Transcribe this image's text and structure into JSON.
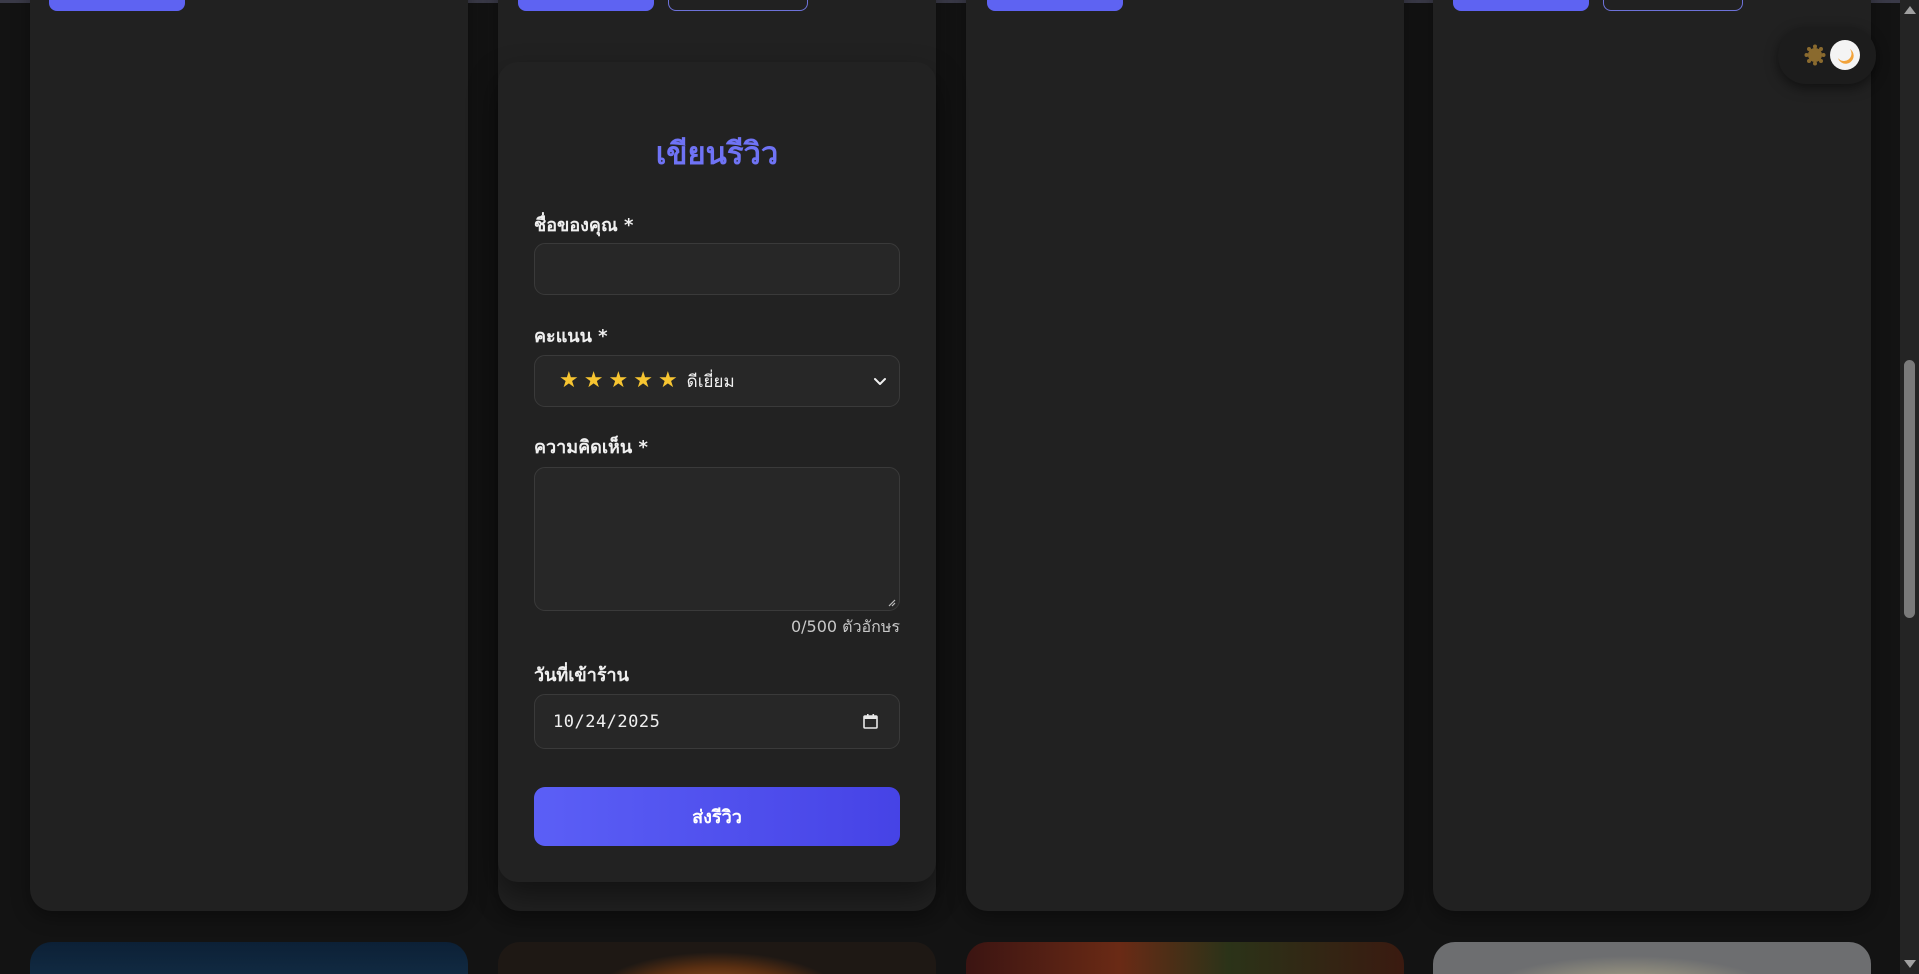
{
  "review_form": {
    "title": "เขียนรีวิว",
    "name_label": "ชื่อของคุณ *",
    "name_value": "",
    "rating_label": "คะแนน *",
    "rating_stars": 5,
    "rating_text": "ดีเยี่ยม",
    "comment_label": "ความคิดเห็น *",
    "comment_value": "",
    "char_count": "0/500 ตัวอักษร",
    "visit_date_label": "วันที่เข้าร้าน",
    "visit_date_value": "10/24/2025",
    "submit_label": "ส่งรีวิว"
  },
  "theme_toggle": {
    "mode": "dark",
    "icons": [
      "sun-icon",
      "moon-icon"
    ]
  },
  "colors": {
    "accent": "#5e63f2",
    "star": "#f7c531",
    "card_bg": "#212121",
    "page_bg": "#131313"
  },
  "scrollbar": {
    "position": 0.45
  }
}
